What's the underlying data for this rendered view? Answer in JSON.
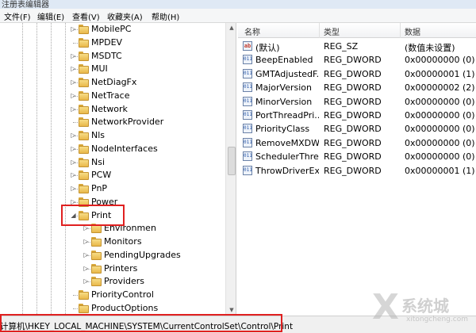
{
  "window": {
    "title": "注册表编辑器"
  },
  "menu": [
    "文件(F)",
    "编辑(E)",
    "查看(V)",
    "收藏夹(A)",
    "帮助(H)"
  ],
  "tree": {
    "items": [
      {
        "label": "MobilePC",
        "level": 0,
        "expander": "collapsed"
      },
      {
        "label": "MPDEV",
        "level": 0,
        "expander": "none"
      },
      {
        "label": "MSDTC",
        "level": 0,
        "expander": "collapsed"
      },
      {
        "label": "MUI",
        "level": 0,
        "expander": "collapsed"
      },
      {
        "label": "NetDiagFx",
        "level": 0,
        "expander": "collapsed"
      },
      {
        "label": "NetTrace",
        "level": 0,
        "expander": "collapsed"
      },
      {
        "label": "Network",
        "level": 0,
        "expander": "collapsed"
      },
      {
        "label": "NetworkProvider",
        "level": 0,
        "expander": "none"
      },
      {
        "label": "Nls",
        "level": 0,
        "expander": "collapsed"
      },
      {
        "label": "NodeInterfaces",
        "level": 0,
        "expander": "collapsed"
      },
      {
        "label": "Nsi",
        "level": 0,
        "expander": "collapsed"
      },
      {
        "label": "PCW",
        "level": 0,
        "expander": "collapsed"
      },
      {
        "label": "PnP",
        "level": 0,
        "expander": "collapsed"
      },
      {
        "label": "Power",
        "level": 0,
        "expander": "collapsed"
      },
      {
        "label": "Print",
        "level": 0,
        "expander": "expanded"
      },
      {
        "label": "Environmen",
        "level": 1,
        "expander": "collapsed"
      },
      {
        "label": "Monitors",
        "level": 1,
        "expander": "collapsed"
      },
      {
        "label": "PendingUpgrades",
        "level": 1,
        "expander": "collapsed"
      },
      {
        "label": "Printers",
        "level": 1,
        "expander": "collapsed"
      },
      {
        "label": "Providers",
        "level": 1,
        "expander": "collapsed"
      },
      {
        "label": "PriorityControl",
        "level": 0,
        "expander": "none"
      },
      {
        "label": "ProductOptions",
        "level": 0,
        "expander": "none"
      }
    ]
  },
  "list": {
    "columns": [
      "名称",
      "类型",
      "数据"
    ],
    "rows": [
      {
        "icon": "string-value-icon",
        "badge": "ab",
        "name": "(默认)",
        "type": "REG_SZ",
        "data": "(数值未设置)"
      },
      {
        "icon": "dword-value-icon",
        "badge": "011",
        "name": "BeepEnabled",
        "type": "REG_DWORD",
        "data": "0x00000000 (0)"
      },
      {
        "icon": "dword-value-icon",
        "badge": "011",
        "name": "GMTAdjustedF...",
        "type": "REG_DWORD",
        "data": "0x00000001 (1)"
      },
      {
        "icon": "dword-value-icon",
        "badge": "011",
        "name": "MajorVersion",
        "type": "REG_DWORD",
        "data": "0x00000002 (2)"
      },
      {
        "icon": "dword-value-icon",
        "badge": "011",
        "name": "MinorVersion",
        "type": "REG_DWORD",
        "data": "0x00000000 (0)"
      },
      {
        "icon": "dword-value-icon",
        "badge": "011",
        "name": "PortThreadPri...",
        "type": "REG_DWORD",
        "data": "0x00000000 (0)"
      },
      {
        "icon": "dword-value-icon",
        "badge": "011",
        "name": "PriorityClass",
        "type": "REG_DWORD",
        "data": "0x00000000 (0)"
      },
      {
        "icon": "dword-value-icon",
        "badge": "011",
        "name": "RemoveMXDW",
        "type": "REG_DWORD",
        "data": "0x00000000 (0)"
      },
      {
        "icon": "dword-value-icon",
        "badge": "011",
        "name": "SchedulerThre...",
        "type": "REG_DWORD",
        "data": "0x00000000 (0)"
      },
      {
        "icon": "dword-value-icon",
        "badge": "011",
        "name": "ThrowDriverEx...",
        "type": "REG_DWORD",
        "data": "0x00000001 (1)"
      }
    ]
  },
  "status": {
    "path": "计算机\\HKEY_LOCAL_MACHINE\\SYSTEM\\CurrentControlSet\\Control\\Print"
  },
  "watermark": {
    "cn": "系统城",
    "en": "xitongcheng.com"
  },
  "colors": {
    "highlight": "#e02020",
    "folder": "#e9b84a"
  }
}
